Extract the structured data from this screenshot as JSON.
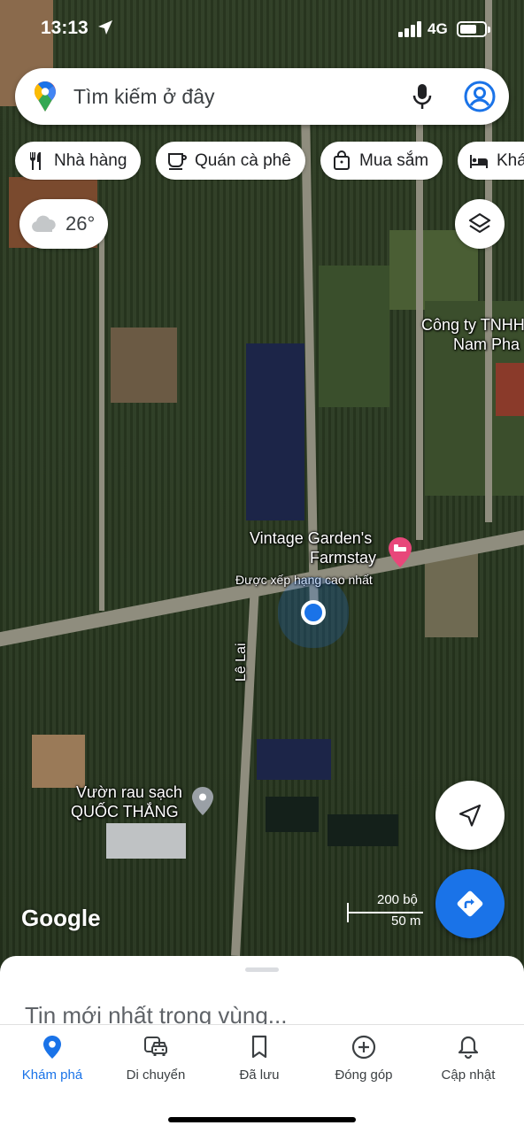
{
  "status_bar": {
    "time": "13:13",
    "network": "4G"
  },
  "search": {
    "placeholder": "Tìm kiếm ở đây",
    "icons": [
      "maps-pin-icon",
      "mic-icon",
      "account-icon"
    ]
  },
  "chips": [
    {
      "label": "Nhà hàng",
      "icon": "fork-knife-icon"
    },
    {
      "label": "Quán cà phê",
      "icon": "coffee-cup-icon"
    },
    {
      "label": "Mua sắm",
      "icon": "shopping-bag-icon"
    },
    {
      "label": "Khá",
      "icon": "bed-icon"
    }
  ],
  "weather": {
    "temperature": "26°",
    "icon": "cloud-icon"
  },
  "map": {
    "labels": {
      "company_line1": "Công ty TNHH",
      "company_line2": "Nam Pha",
      "farmstay_line1": "Vintage Garden's",
      "farmstay_line2": "Farmstay",
      "farmstay_rating": "Được xếp hạng cao nhất",
      "street": "Lê Lai",
      "garden_line1": "Vườn rau sạch",
      "garden_line2": "QUỐC THẮNG"
    },
    "logo": "Google",
    "scale": {
      "top": "200 bộ",
      "bottom": "50 m"
    }
  },
  "sheet": {
    "headline": "Tin mới nhất trong vùng..."
  },
  "nav": [
    {
      "label": "Khám phá",
      "icon": "explore-pin-icon",
      "active": true
    },
    {
      "label": "Di chuyển",
      "icon": "commute-icon",
      "active": false
    },
    {
      "label": "Đã lưu",
      "icon": "bookmark-icon",
      "active": false
    },
    {
      "label": "Đóng góp",
      "icon": "add-circle-icon",
      "active": false
    },
    {
      "label": "Cập nhật",
      "icon": "bell-icon",
      "active": false
    }
  ],
  "colors": {
    "accent": "#1a73e8",
    "poi_pink": "#e8477a"
  }
}
